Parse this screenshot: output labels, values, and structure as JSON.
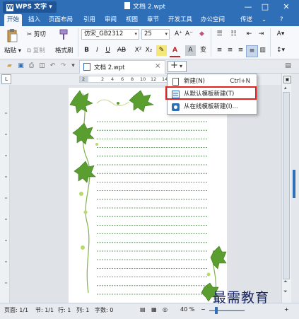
{
  "window": {
    "app_name": "WPS 文字",
    "doc_title": "文档 2.wpt",
    "controls": [
      "—",
      "□",
      "✕"
    ]
  },
  "menu": {
    "items": [
      "开始",
      "插入",
      "页面布局",
      "引用",
      "审阅",
      "视图",
      "章节",
      "开发工具",
      "办公空间"
    ],
    "active": "开始",
    "right_label": "传送",
    "right_icons": [
      "⌄",
      "?"
    ]
  },
  "ribbon": {
    "paste_label": "粘贴",
    "cut_label": "剪切",
    "copy_label": "复制",
    "format_painter_label": "格式刷",
    "font_name": "仿宋_GB2312",
    "font_size": "25",
    "bold": "B",
    "italic": "I",
    "underline": "U",
    "strike": "AB",
    "superscript": "X²",
    "subscript": "X₂",
    "font_color": "A",
    "grow_font": "A⁺",
    "shrink_font": "A⁻",
    "char_shade": "A"
  },
  "tabbar": {
    "doc_tab": "文档 2.wpt",
    "close": "×",
    "plus": "+",
    "plus_arrow": "▾"
  },
  "ruler": {
    "ticks": [
      "2",
      "2",
      "4",
      "6",
      "8",
      "10",
      "12",
      "14"
    ]
  },
  "dropdown": {
    "items": [
      {
        "label": "新建(N)",
        "shortcut": "Ctrl+N"
      },
      {
        "label": "从默认模板新建(T)",
        "shortcut": ""
      },
      {
        "label": "从在线模板新建(I)...",
        "shortcut": ""
      }
    ],
    "highlighted_index": 1
  },
  "status": {
    "page": "页面: 1/1",
    "section": "节: 1/1",
    "line": "行: 1",
    "column": "列: 1",
    "words": "字数: 0",
    "zoom": "40 %",
    "zoom_minus": "−",
    "zoom_plus": "+"
  },
  "watermark": "最需教育",
  "colors": {
    "titlebar": "#2f6fb8",
    "highlight_border": "#e0231e",
    "vine_green": "#5a9e2f",
    "dash_line": "#3a7f3a"
  }
}
